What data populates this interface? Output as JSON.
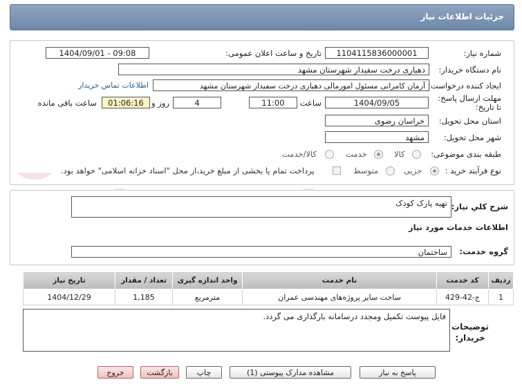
{
  "header": {
    "title": "جزئیات اطلاعات نیاز"
  },
  "form": {
    "need_number_label": "شماره نیاز:",
    "need_number": "1104115836000001",
    "announce_label": "تاریخ و ساعت اعلان عمومی:",
    "announce_value": "1404/09/01 - 09:08",
    "buyer_org_label": "نام دستگاه خریدار:",
    "buyer_org": "دهیاری درخت سفیدار شهرستان مشهد",
    "creator_label": "ایجاد کننده درخواست:",
    "creator": "آرمان کامرانی مسئول امورمالی دهیاری درخت سفیدار شهرستان مشهد",
    "contact_link": "اطلاعات تماس خریدار",
    "deadline_label": "مهلت ارسال پاسخ: تا تاریخ:",
    "deadline_date": "1404/09/05",
    "time_label": "ساعت",
    "deadline_time": "11:00",
    "days": "4",
    "days_label": "روز و",
    "remaining": "01:06:16",
    "remaining_label": "ساعت باقی مانده",
    "province_label": "استان محل تحویل:",
    "province": "خراسان رضوی",
    "city_label": "شهر محل تحویل:",
    "city": "مشهد",
    "category_label": "طبقه بندی موضوعی:",
    "category_options": [
      "کالا",
      "خدمت",
      "کالا/خدمت"
    ],
    "purchase_label": "نوع فرآیند خرید :",
    "purchase_options": [
      "جزیی",
      "متوسط"
    ],
    "payment_note": "پرداخت تمام یا بخشی از مبلغ خرید،از محل \"اسناد خزانه اسلامی\" خواهد بود."
  },
  "summary": {
    "label": "شرح کلي نياز:",
    "value": "تهیه پارک کودک",
    "services_title": "اطلاعات خدمات مورد نیاز",
    "group_label": "گروه خدمت:",
    "group_value": "ساختمان"
  },
  "table": {
    "headers": [
      "ردیف",
      "کد خدمت",
      "نام خدمت",
      "واحد اندازه گیری",
      "تعداد / مقدار",
      "تاریخ نیاز"
    ],
    "rows": [
      [
        "1",
        "ج-42-429",
        "ساخت سایر پروژه‌های مهندسی عمران",
        "مترمربع",
        "1,185",
        "1404/12/29"
      ]
    ]
  },
  "notes": {
    "label": "توضیحات خریدار:",
    "value": "فایل پیوست  تکمیل ومجدد درسامانه بارگذاری می گردد."
  },
  "buttons": {
    "reply": "پاسخ به نیاز",
    "attachments": "مشاهده مدارک پیوستی (1)",
    "print": "چاپ",
    "back": "بازگشت",
    "exit": "خروج"
  },
  "watermark": {
    "text": "AriaTender.neT"
  }
}
